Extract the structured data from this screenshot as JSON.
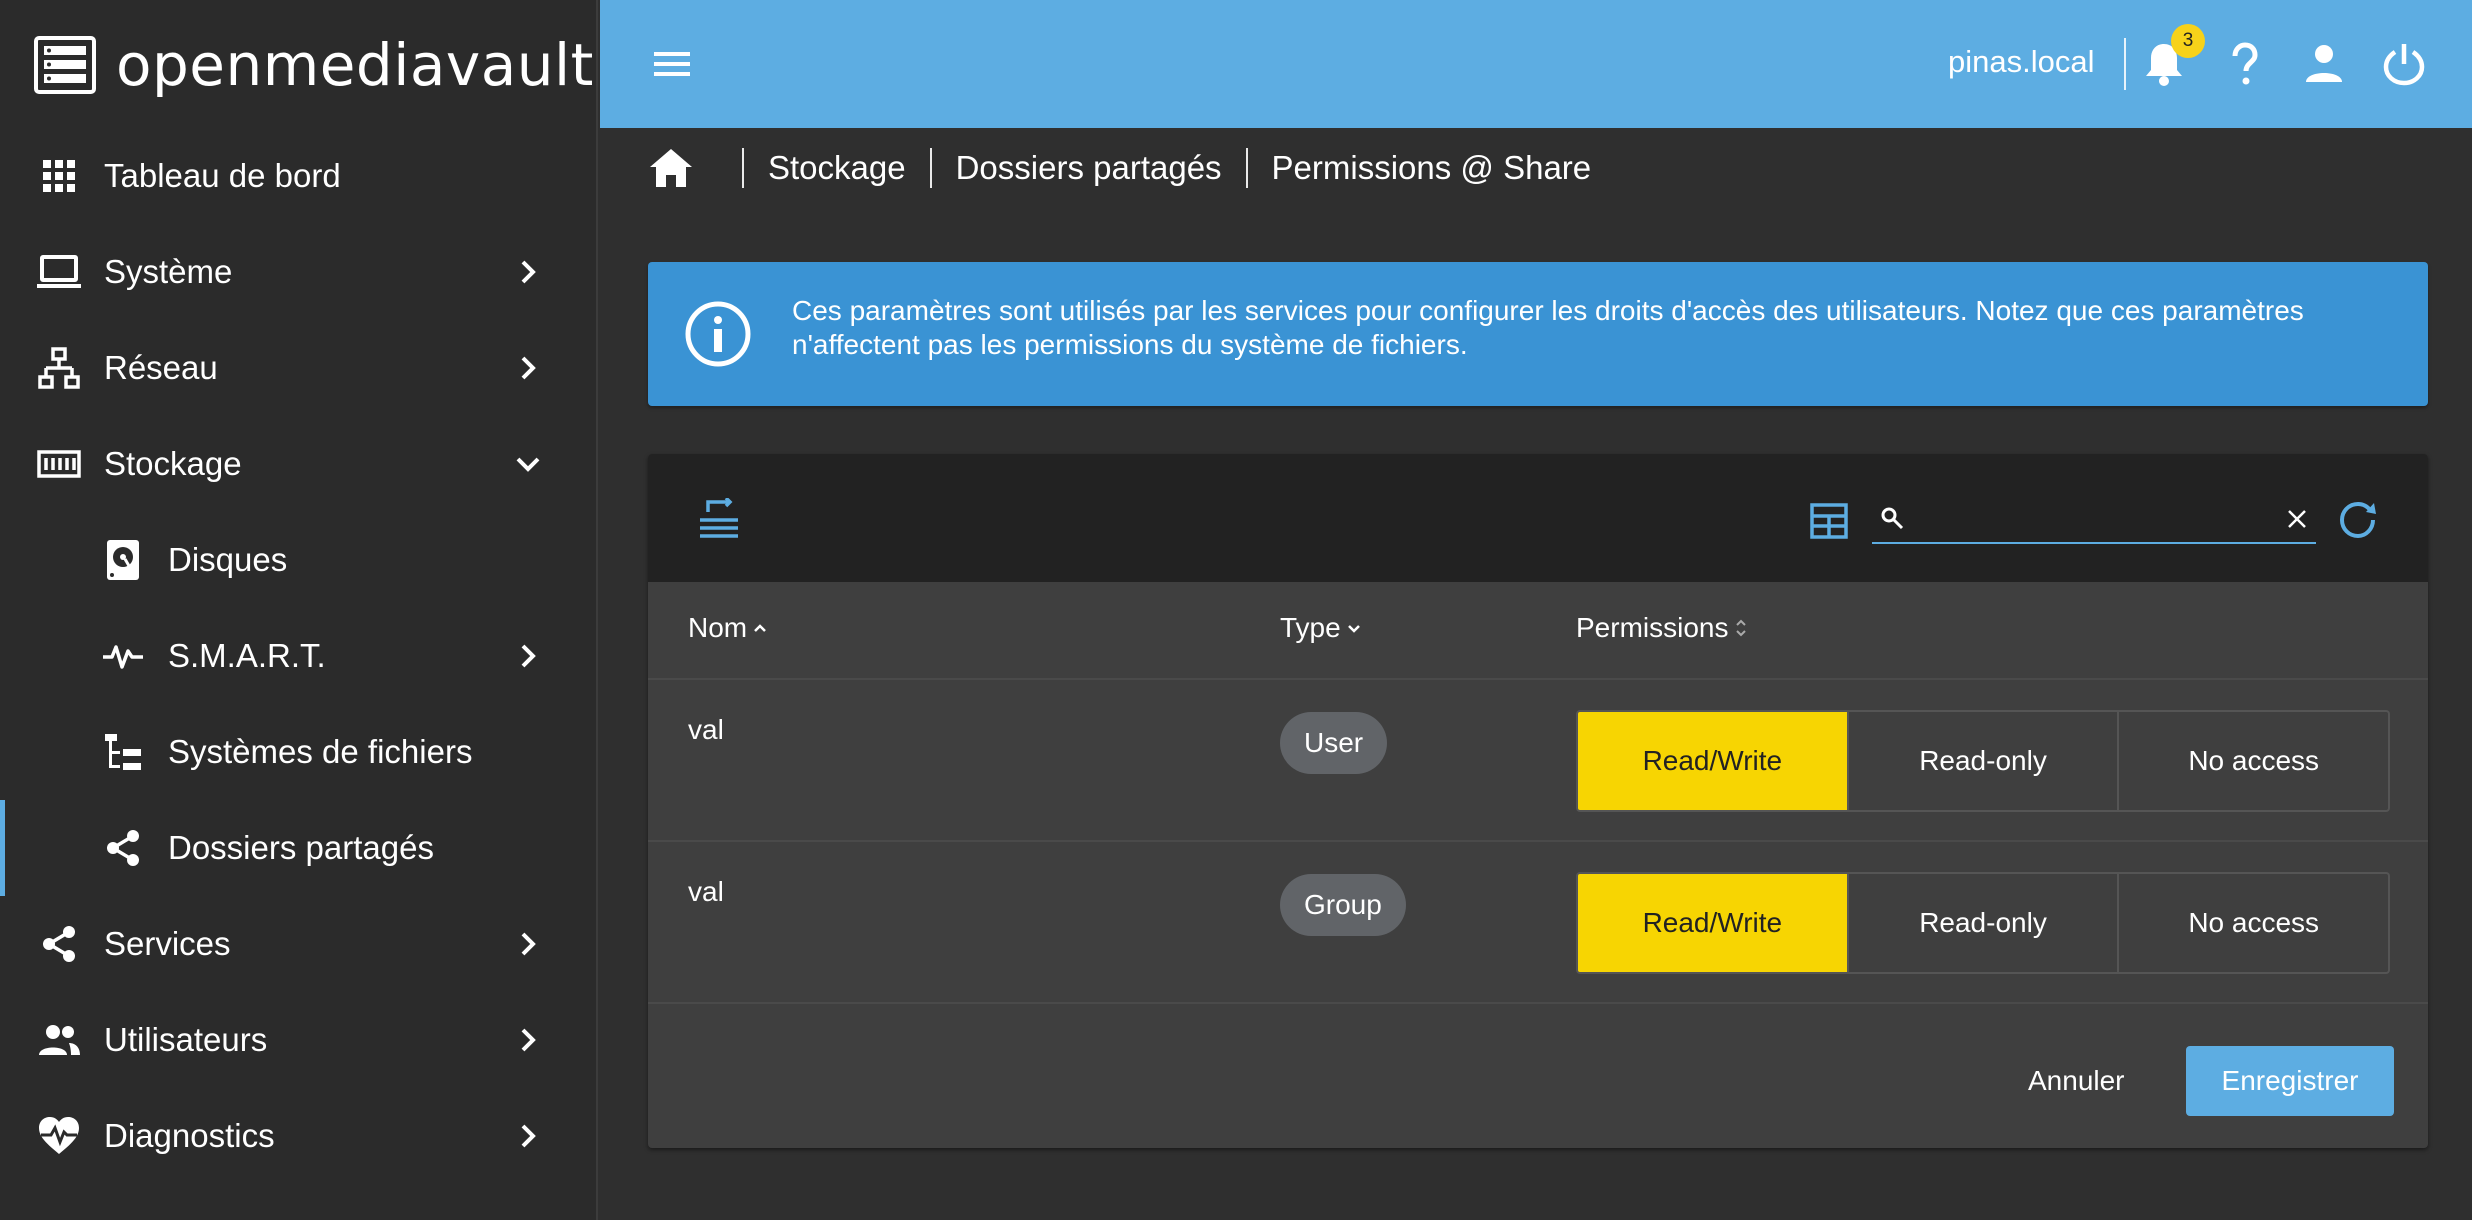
{
  "app": {
    "brand": "openmediavault",
    "hostname": "pinas.local",
    "notification_count": "3"
  },
  "colors": {
    "accent": "#5dade2",
    "info": "#3a93d4",
    "selected": "#f7d502",
    "sidebar_bg": "#2b2b2b",
    "content_bg": "#2f2f2f"
  },
  "sidebar": {
    "items": [
      {
        "label": "Tableau de bord",
        "icon": "grid-icon"
      },
      {
        "label": "Système",
        "icon": "laptop-icon"
      },
      {
        "label": "Réseau",
        "icon": "network-icon"
      },
      {
        "label": "Stockage",
        "icon": "storage-icon"
      },
      {
        "label": "Disques",
        "icon": "disk-icon"
      },
      {
        "label": "S.M.A.R.T.",
        "icon": "pulse-icon"
      },
      {
        "label": "Systèmes de fichiers",
        "icon": "tree-icon"
      },
      {
        "label": "Dossiers partagés",
        "icon": "share-icon"
      },
      {
        "label": "Services",
        "icon": "share-icon"
      },
      {
        "label": "Utilisateurs",
        "icon": "users-icon"
      },
      {
        "label": "Diagnostics",
        "icon": "heart-pulse-icon"
      }
    ]
  },
  "breadcrumb": {
    "items": [
      "Stockage",
      "Dossiers partagés",
      "Permissions @ Share"
    ]
  },
  "alert": {
    "text": "Ces paramètres sont utilisés par les services pour configurer les droits d'accès des utilisateurs. Notez que ces paramètres n'affectent pas les permissions du système de fichiers."
  },
  "search": {
    "value": "",
    "placeholder": ""
  },
  "table": {
    "columns": [
      "Nom",
      "Type",
      "Permissions"
    ],
    "rows": [
      {
        "name": "val",
        "type": "User",
        "permission": "Read/Write"
      },
      {
        "name": "val",
        "type": "Group",
        "permission": "Read/Write"
      }
    ],
    "permission_options": [
      "Read/Write",
      "Read-only",
      "No access"
    ]
  },
  "actions": {
    "cancel": "Annuler",
    "save": "Enregistrer"
  }
}
